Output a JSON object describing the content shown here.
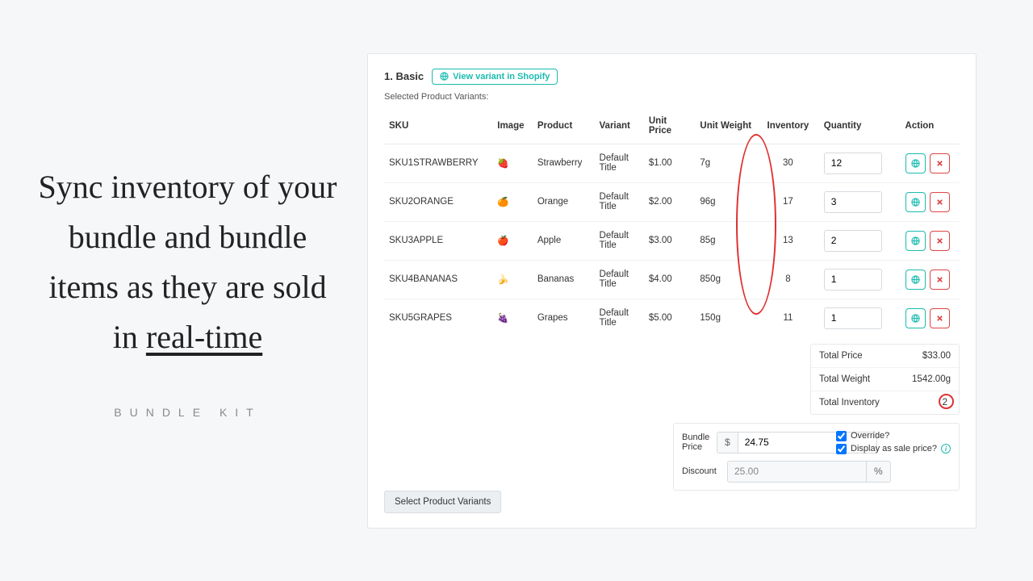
{
  "left": {
    "headline_pre": "Sync inventory of your bundle and bundle items as they are sold in ",
    "headline_underline": "real-time",
    "brand": "BUNDLE KIT"
  },
  "header": {
    "title": "1. Basic",
    "view_btn": "View variant in Shopify",
    "subtext": "Selected Product Variants:"
  },
  "cols": {
    "sku": "SKU",
    "image": "Image",
    "product": "Product",
    "variant": "Variant",
    "unit_price": "Unit Price",
    "unit_weight": "Unit Weight",
    "inventory": "Inventory",
    "quantity": "Quantity",
    "action": "Action"
  },
  "rows": [
    {
      "sku": "SKU1STRAWBERRY",
      "emoji": "🍓",
      "product": "Strawberry",
      "variant": "Default Title",
      "price": "$1.00",
      "weight": "7g",
      "inv": "30",
      "qty": "12"
    },
    {
      "sku": "SKU2ORANGE",
      "emoji": "🍊",
      "product": "Orange",
      "variant": "Default Title",
      "price": "$2.00",
      "weight": "96g",
      "inv": "17",
      "qty": "3"
    },
    {
      "sku": "SKU3APPLE",
      "emoji": "🍎",
      "product": "Apple",
      "variant": "Default Title",
      "price": "$3.00",
      "weight": "85g",
      "inv": "13",
      "qty": "2"
    },
    {
      "sku": "SKU4BANANAS",
      "emoji": "🍌",
      "product": "Bananas",
      "variant": "Default Title",
      "price": "$4.00",
      "weight": "850g",
      "inv": "8",
      "qty": "1"
    },
    {
      "sku": "SKU5GRAPES",
      "emoji": "🍇",
      "product": "Grapes",
      "variant": "Default Title",
      "price": "$5.00",
      "weight": "150g",
      "inv": "11",
      "qty": "1"
    }
  ],
  "totals": {
    "price_label": "Total Price",
    "price_val": "$33.00",
    "weight_label": "Total Weight",
    "weight_val": "1542.00g",
    "inv_label": "Total Inventory",
    "inv_val": "2"
  },
  "bundle": {
    "price_label": "Bundle Price",
    "currency": "$",
    "price_val": "24.75",
    "override_label": "Override?",
    "sale_label": "Display as sale price?",
    "discount_label": "Discount",
    "discount_val": "25.00",
    "discount_suffix": "%"
  },
  "footer": {
    "select_btn": "Select Product Variants"
  }
}
